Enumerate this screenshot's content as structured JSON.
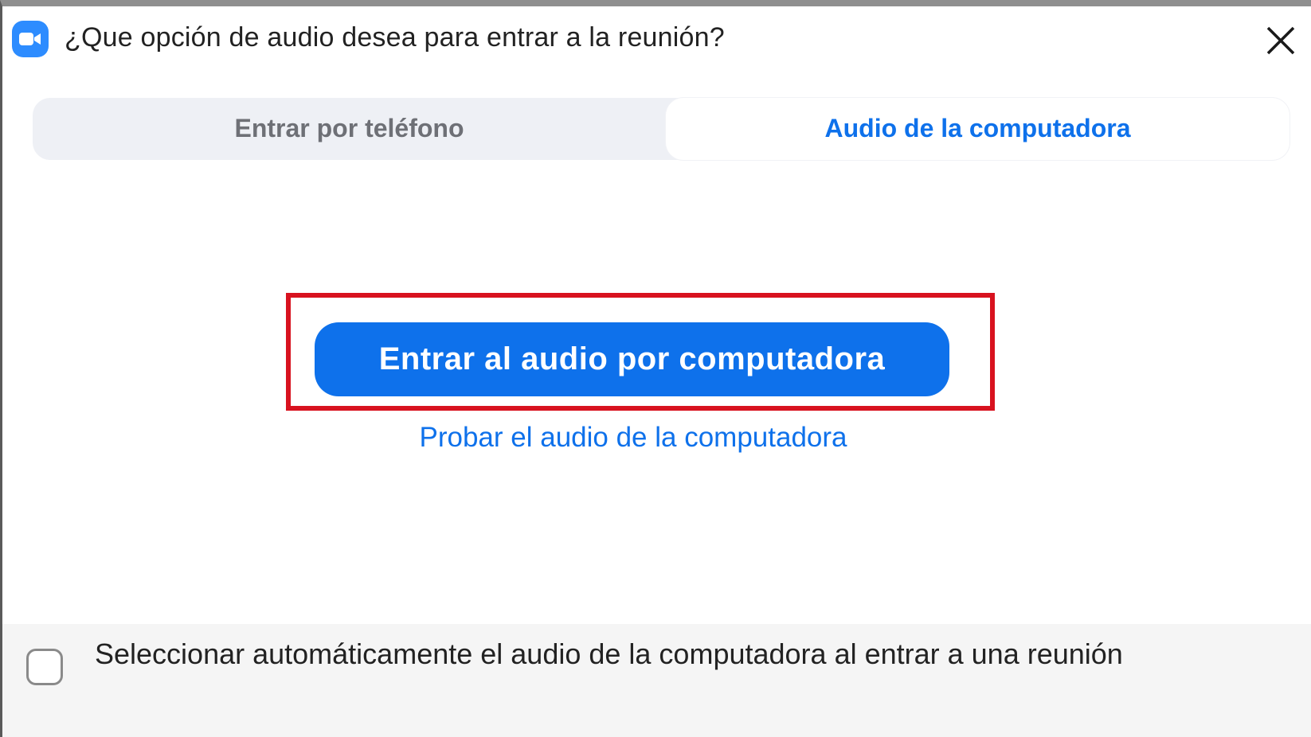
{
  "window": {
    "title": "¿Que opción de audio desea para entrar a la reunión?",
    "app_icon": "zoom-camera-icon",
    "close_icon": "close-icon"
  },
  "tabs": [
    {
      "label": "Entrar por teléfono",
      "selected": false
    },
    {
      "label": "Audio de la computadora",
      "selected": true
    }
  ],
  "main": {
    "join_button_label": "Entrar al audio por computadora",
    "test_link_label": "Probar el audio de la computadora"
  },
  "footer": {
    "auto_select_label": "Seleccionar automáticamente el audio de la computadora al entrar a una reunión",
    "auto_select_checked": false
  },
  "colors": {
    "accent": "#0e71eb",
    "highlight_border": "#d8121f",
    "app_icon_bg": "#2d8cff",
    "tab_bar_bg": "#eef0f5",
    "footer_bg": "#f5f5f5"
  }
}
